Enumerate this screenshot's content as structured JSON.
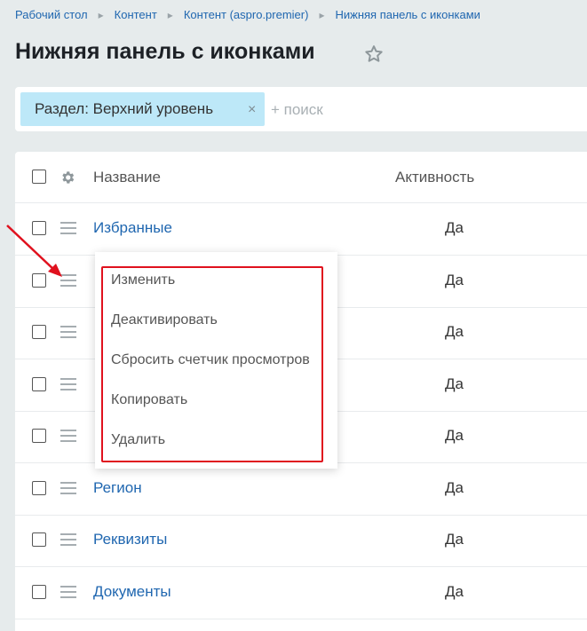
{
  "breadcrumb": [
    "Рабочий стол",
    "Контент",
    "Контент (aspro.premier)",
    "Нижняя панель с иконками"
  ],
  "page": {
    "title": "Нижняя панель с иконками"
  },
  "filter": {
    "chip_label": "Раздел: Верхний уровень",
    "chip_remove": "×",
    "search_placeholder": "+ поиск"
  },
  "grid": {
    "columns": {
      "name": "Название",
      "active": "Активность"
    },
    "rows": [
      {
        "name": "Избранные",
        "active": "Да"
      },
      {
        "name": "",
        "active": "Да"
      },
      {
        "name": "",
        "active": "Да"
      },
      {
        "name": "",
        "active": "Да"
      },
      {
        "name": "",
        "active": "Да"
      },
      {
        "name": "Регион",
        "active": "Да"
      },
      {
        "name": "Реквизиты",
        "active": "Да"
      },
      {
        "name": "Документы",
        "active": "Да"
      }
    ]
  },
  "context_menu": [
    "Изменить",
    "Деактивировать",
    "Сбросить счетчик просмотров",
    "Копировать",
    "Удалить"
  ],
  "colors": {
    "link": "#2067b0",
    "highlight": "#e0111e",
    "chip": "#bde8f8",
    "background": "#e6ebec"
  }
}
